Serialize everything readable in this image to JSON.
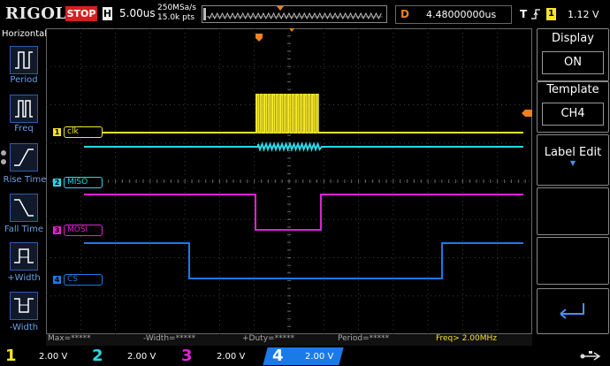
{
  "header": {
    "logo": "RIGOL",
    "run_state": "STOP",
    "timebase_mode": "H",
    "timebase": "5.00us",
    "sample_rate": "250MSa/s",
    "memory_depth": "15.0k pts",
    "delay_label": "D",
    "delay_value": "4.48000000us",
    "trigger_label": "T",
    "trigger_source": "1",
    "trigger_level": "1.12 V"
  },
  "left_menu": {
    "title": "Horizontal",
    "items": [
      {
        "label": "Period",
        "icon": "period-icon"
      },
      {
        "label": "Freq",
        "icon": "freq-icon"
      },
      {
        "label": "Rise Time",
        "icon": "rise-time-icon"
      },
      {
        "label": "Fall Time",
        "icon": "fall-time-icon"
      },
      {
        "label": "+Width",
        "icon": "pos-width-icon"
      },
      {
        "label": "-Width",
        "icon": "neg-width-icon"
      }
    ]
  },
  "right_menu": {
    "display_title": "Display",
    "display_value": "ON",
    "template_title": "Template",
    "template_value": "CH4",
    "label_edit": "Label Edit"
  },
  "channels": [
    {
      "num": "1",
      "label": "clk",
      "scale": "2.00 V",
      "color": "#f4e42a"
    },
    {
      "num": "2",
      "label": "MISO",
      "scale": "2.00 V",
      "color": "#2ad8e8"
    },
    {
      "num": "3",
      "label": "MOSI",
      "scale": "2.00 V",
      "color": "#e020d8"
    },
    {
      "num": "4",
      "label": "CS",
      "scale": "2.00 V",
      "color": "#1a7ae8"
    }
  ],
  "measurements": [
    "Max=*****",
    "-Width=*****",
    "+Duty=*****",
    "Period=*****",
    "Freq> 2.00MHz"
  ],
  "colors": {
    "grid": "#3a3a3a",
    "accent_orange": "#f08020",
    "menu_blue": "#2f5ea8"
  }
}
